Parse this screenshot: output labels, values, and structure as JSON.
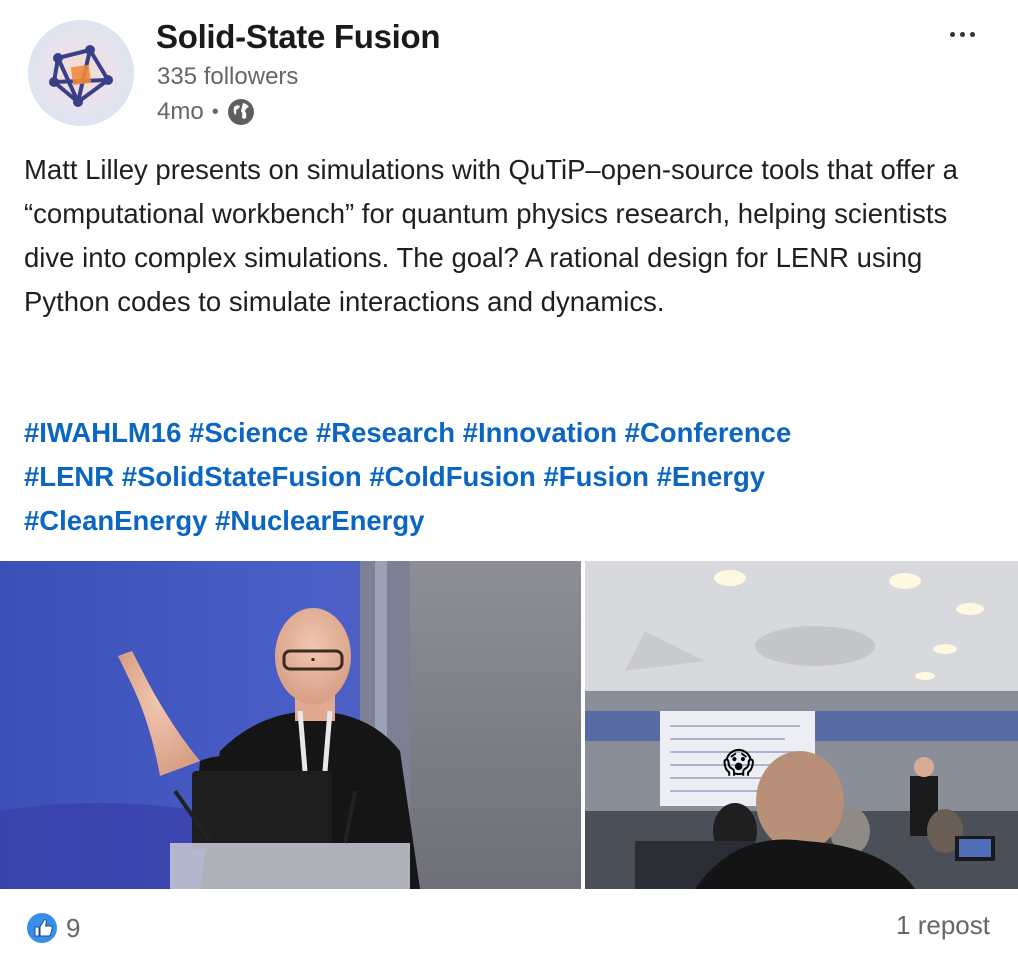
{
  "post": {
    "author": {
      "name": "Solid-State Fusion",
      "followers": "335 followers",
      "time": "4mo",
      "separator": "•",
      "visibility_icon": "globe-icon"
    },
    "menu_icon": "more-horizontal-icon",
    "body": "Matt Lilley presents on simulations with QuTiP–open-source tools that offer a “computational workbench” for quantum physics research, helping scientists dive into complex simulations. The goal? A rational design for LENR using Python codes to simulate interactions and dynamics.",
    "hashtags": [
      "#IWAHLM16",
      "#Science",
      "#Research",
      "#Innovation",
      "#Conference",
      "#LENR",
      "#SolidStateFusion",
      "#ColdFusion",
      "#Fusion",
      "#Energy",
      "#CleanEnergy",
      "#NuclearEnergy"
    ],
    "images": [
      {
        "subject": "speaker-at-podium-photo"
      },
      {
        "subject": "conference-room-audience-photo",
        "emoji": "😱"
      }
    ],
    "footer": {
      "reaction_icon": "like-icon",
      "reaction_count": "9",
      "reposts": "1 repost"
    }
  },
  "colors": {
    "link": "#0a66c2",
    "muted": "#666666",
    "text": "#1f1f1f"
  }
}
